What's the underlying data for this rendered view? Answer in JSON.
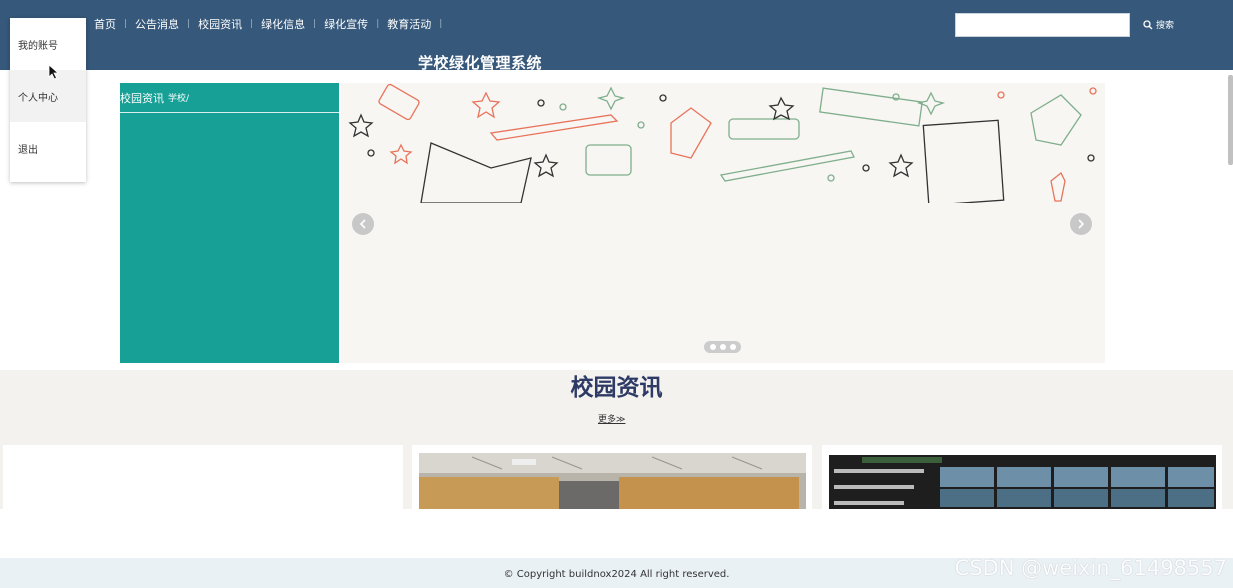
{
  "nav": {
    "items": [
      {
        "label": "首页"
      },
      {
        "label": "公告消息"
      },
      {
        "label": "校园资讯"
      },
      {
        "label": "绿化信息"
      },
      {
        "label": "绿化宣传"
      },
      {
        "label": "教育活动"
      }
    ],
    "separator": "|"
  },
  "site_title": "学校绿化管理系统",
  "search": {
    "value": "",
    "button_label": "搜索"
  },
  "account_menu": {
    "items": [
      {
        "label": "我的账号"
      },
      {
        "label": "个人中心"
      },
      {
        "label": "退出"
      }
    ]
  },
  "left_panel": {
    "title": "校园资讯",
    "breadcrumb": "学校/"
  },
  "section": {
    "title": "校园资讯",
    "more_label": "更多≫"
  },
  "footer": {
    "copyright": "© Copyright buildnox2024   All right reserved."
  },
  "watermark": "CSDN @weixin_61498557",
  "colors": {
    "header": "#36587a",
    "teal_panel": "#17a095",
    "section_bg": "#f3f2ef",
    "footer_bg": "#eaf1f5"
  }
}
